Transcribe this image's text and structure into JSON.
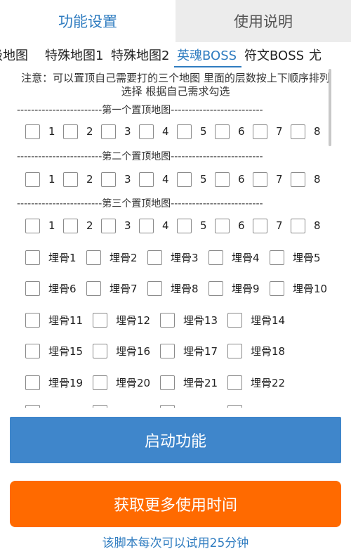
{
  "top_tabs": [
    {
      "label": "功能设置",
      "active": true
    },
    {
      "label": "使用说明",
      "active": false
    }
  ],
  "sub_tabs": [
    {
      "label": "级地图",
      "active": false
    },
    {
      "label": "特殊地图1",
      "active": false
    },
    {
      "label": "特殊地图2",
      "active": false
    },
    {
      "label": "英魂BOSS",
      "active": true
    },
    {
      "label": "符文BOSS",
      "active": false
    },
    {
      "label": "尤",
      "active": false
    }
  ],
  "notice": "注意：可以置顶自己需要打的三个地图 里面的层数按上下顺序排列选择 根据自己需求勾选",
  "dividers": [
    "------------------------第一个置顶地图--------------------------",
    "------------------------第二个置顶地图--------------------------",
    "------------------------第三个置顶地图--------------------------"
  ],
  "level_options": [
    "1",
    "2",
    "3",
    "4",
    "5",
    "6",
    "7",
    "8"
  ],
  "burial_rows": [
    [
      "埋骨1",
      "埋骨2",
      "埋骨3",
      "埋骨4",
      "埋骨5"
    ],
    [
      "埋骨6",
      "埋骨7",
      "埋骨8",
      "埋骨9",
      "埋骨10"
    ],
    [
      "埋骨11",
      "埋骨12",
      "埋骨13",
      "埋骨14"
    ],
    [
      "埋骨15",
      "埋骨16",
      "埋骨17",
      "埋骨18"
    ],
    [
      "埋骨19",
      "埋骨20",
      "埋骨21",
      "埋骨22"
    ]
  ],
  "buttons": {
    "start": "启动功能",
    "get_more_time": "获取更多使用时间"
  },
  "trial_note": "该脚本每次可以试用25分钟",
  "colors": {
    "accent_blue": "#3f86cb",
    "cta_orange": "#ff6a00",
    "link_blue": "#2f7cc0"
  }
}
